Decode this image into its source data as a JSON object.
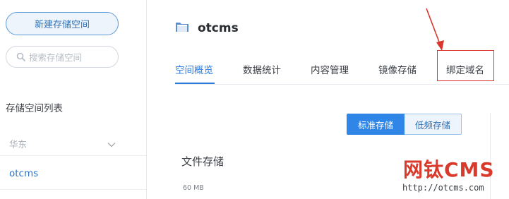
{
  "sidebar": {
    "new_bucket_label": "新建存储空间",
    "search_placeholder": "搜索存储空间",
    "list_title": "存储空间列表",
    "region_label": "华东",
    "bucket_item": "otcms"
  },
  "bucket": {
    "name": "otcms"
  },
  "tabs": [
    {
      "label": "空间概览",
      "active": true
    },
    {
      "label": "数据统计",
      "active": false
    },
    {
      "label": "内容管理",
      "active": false
    },
    {
      "label": "镜像存储",
      "active": false
    },
    {
      "label": "绑定域名",
      "active": false
    }
  ],
  "storage_toggle": {
    "standard_label": "标准存储",
    "low_freq_label": "低频存储",
    "selected": "标准存储"
  },
  "file_storage": {
    "title": "文件存储",
    "size_label": "60 MB"
  },
  "watermark": {
    "title": "网钛CMS",
    "url": "http://otcms.com"
  },
  "colors": {
    "accent": "#2b7ad9",
    "highlight_border": "#d9352b",
    "watermark": "#d93a2b"
  },
  "icons": {
    "search": "search-icon",
    "chevron": "chevron-down-icon",
    "folder": "folder-icon",
    "arrow": "annotation-arrow-icon"
  }
}
